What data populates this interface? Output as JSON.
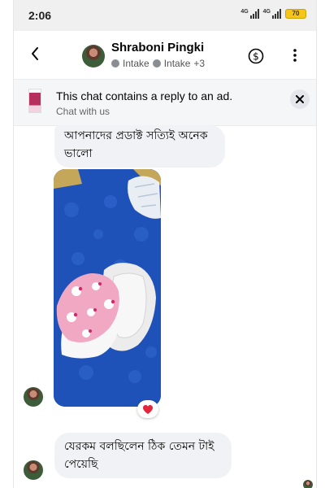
{
  "status_bar": {
    "time": "2:06",
    "network_1": "4G",
    "network_2": "4G",
    "battery": "70"
  },
  "header": {
    "name": "Shraboni Pingki",
    "label_1": "Intake",
    "label_2": "Intake",
    "extra_count": "+3"
  },
  "ad_notice": {
    "title": "This chat contains a reply to an ad.",
    "subtitle": "Chat with us"
  },
  "messages": [
    {
      "text": "আপনাদের প্রডাক্ট সত্যিই অনেক ভালো"
    },
    {
      "type": "photo"
    },
    {
      "text": "যেরকম বলছিলেন ঠিক তেমন টাই পেয়েছি"
    }
  ],
  "reaction": "heart",
  "icons": [
    "back-icon",
    "dollar-icon",
    "more-icon",
    "close-icon",
    "heart-icon"
  ],
  "colors": {
    "bubble": "#f0f2f5",
    "label_dot": "#8a8d91",
    "photo_bg": "#1f52b8",
    "heart": "#e4253a"
  }
}
